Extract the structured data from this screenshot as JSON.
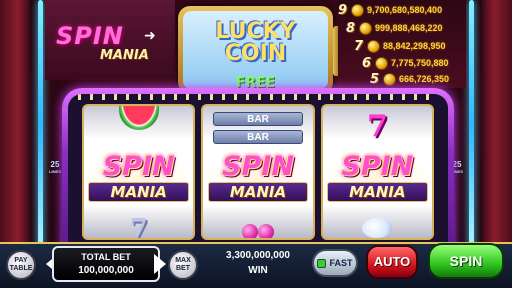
{
  "game": {
    "logo_top": {
      "spin": "SPIN",
      "mania": "MANIA"
    },
    "mini_slot": {
      "line1": "LUCKY",
      "line2": "COIN",
      "free": "FREE"
    }
  },
  "jackpots": [
    {
      "rank": "9",
      "value": "9,700,680,580,400"
    },
    {
      "rank": "8",
      "value": "999,888,468,220"
    },
    {
      "rank": "7",
      "value": "88,842,298,950"
    },
    {
      "rank": "6",
      "value": "7,775,750,880"
    },
    {
      "rank": "5",
      "value": "666,726,350"
    }
  ],
  "reels": {
    "bar_labels": [
      "BAR",
      "BAR"
    ],
    "seven": "7",
    "logo": {
      "spin": "SPIN",
      "mania": "MANIA"
    }
  },
  "lines": {
    "count": "25",
    "label": "LINES"
  },
  "controls": {
    "pay_table": "PAY TABLE",
    "total_bet_label": "TOTAL BET",
    "total_bet_value": "100,000,000",
    "max_bet": "MAX BET",
    "win_amount": "3,300,000,000",
    "win_label": "WIN",
    "fast": "FAST",
    "auto": "AUTO",
    "spin": "SPIN"
  },
  "colors": {
    "spin_button": "#2ec41e",
    "auto_button": "#d0141e",
    "frame": "#8a2fc0",
    "jackpot_text": "#ffd33a"
  }
}
